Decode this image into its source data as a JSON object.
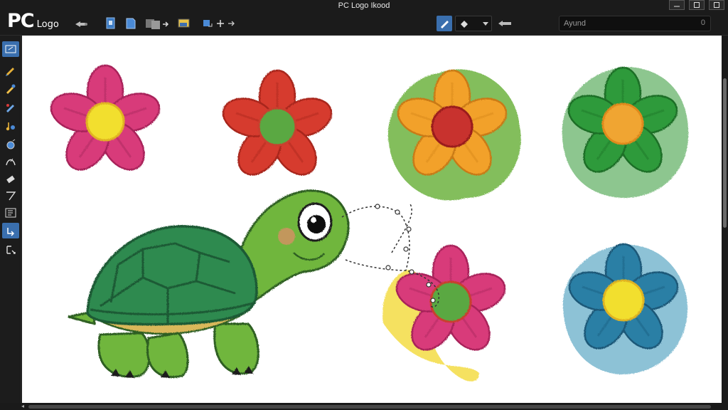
{
  "app": {
    "logo_big": "PC",
    "logo_small": "Logo",
    "window_title": "PC Logo Ikood"
  },
  "toolbar": {
    "search_value": "Ayund",
    "search_end": "0",
    "dropdown_icon": "fill-icon"
  },
  "left_tools": [
    {
      "icon": "select-icon",
      "active": true
    },
    {
      "icon": "pencil-icon"
    },
    {
      "icon": "brush-icon"
    },
    {
      "icon": "pen-icon"
    },
    {
      "icon": "music-turtle-icon"
    },
    {
      "icon": "fill-bucket-icon"
    },
    {
      "icon": "curve-icon"
    },
    {
      "icon": "eraser-icon"
    },
    {
      "icon": "line-icon"
    },
    {
      "icon": "text-icon"
    },
    {
      "icon": "move-icon",
      "active": true
    },
    {
      "icon": "transform-icon"
    }
  ],
  "colors": {
    "accent": "#3a6fae",
    "flower_pink": "#d83b7a",
    "flower_red": "#d63a2e",
    "flower_orange": "#f2a12c",
    "flower_green": "#2f9a3a",
    "flower_teal": "#2b7fa5",
    "turtle_shell": "#2f8a4f",
    "turtle_body": "#6fb63e"
  }
}
